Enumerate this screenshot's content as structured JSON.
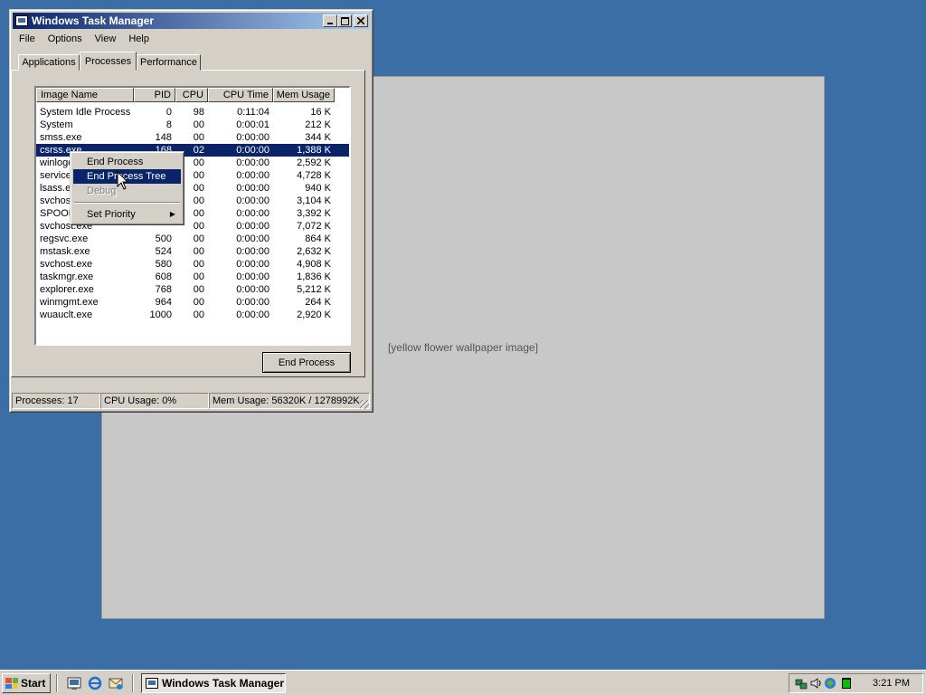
{
  "desktop": {
    "wallpaper_placeholder": "[yellow flower wallpaper image]"
  },
  "window": {
    "title": "Windows Task Manager",
    "menu": [
      "File",
      "Options",
      "View",
      "Help"
    ],
    "tabs": [
      "Applications",
      "Processes",
      "Performance"
    ],
    "active_tab": "Processes",
    "columns": [
      "Image Name",
      "PID",
      "CPU",
      "CPU Time",
      "Mem Usage"
    ],
    "rows": [
      {
        "name": "System Idle Process",
        "pid": "0",
        "cpu": "98",
        "time": "0:11:04",
        "mem": "16 K"
      },
      {
        "name": "System",
        "pid": "8",
        "cpu": "00",
        "time": "0:00:01",
        "mem": "212 K"
      },
      {
        "name": "smss.exe",
        "pid": "148",
        "cpu": "00",
        "time": "0:00:00",
        "mem": "344 K"
      },
      {
        "name": "csrss.exe",
        "pid": "168",
        "cpu": "02",
        "time": "0:00:00",
        "mem": "1,388 K",
        "selected": true
      },
      {
        "name": "winlogon.exe",
        "pid": "",
        "cpu": "00",
        "time": "0:00:00",
        "mem": "2,592 K"
      },
      {
        "name": "services.exe",
        "pid": "",
        "cpu": "00",
        "time": "0:00:00",
        "mem": "4,728 K"
      },
      {
        "name": "lsass.exe",
        "pid": "",
        "cpu": "00",
        "time": "0:00:00",
        "mem": "940 K"
      },
      {
        "name": "svchost.exe",
        "pid": "",
        "cpu": "00",
        "time": "0:00:00",
        "mem": "3,104 K"
      },
      {
        "name": "SPOOLSV.EXE",
        "pid": "",
        "cpu": "00",
        "time": "0:00:00",
        "mem": "3,392 K"
      },
      {
        "name": "svchost.exe",
        "pid": "",
        "cpu": "00",
        "time": "0:00:00",
        "mem": "7,072 K"
      },
      {
        "name": "regsvc.exe",
        "pid": "500",
        "cpu": "00",
        "time": "0:00:00",
        "mem": "864 K"
      },
      {
        "name": "mstask.exe",
        "pid": "524",
        "cpu": "00",
        "time": "0:00:00",
        "mem": "2,632 K"
      },
      {
        "name": "svchost.exe",
        "pid": "580",
        "cpu": "00",
        "time": "0:00:00",
        "mem": "4,908 K"
      },
      {
        "name": "taskmgr.exe",
        "pid": "608",
        "cpu": "00",
        "time": "0:00:00",
        "mem": "1,836 K"
      },
      {
        "name": "explorer.exe",
        "pid": "768",
        "cpu": "00",
        "time": "0:00:00",
        "mem": "5,212 K"
      },
      {
        "name": "winmgmt.exe",
        "pid": "964",
        "cpu": "00",
        "time": "0:00:00",
        "mem": "264 K"
      },
      {
        "name": "wuauclt.exe",
        "pid": "1000",
        "cpu": "00",
        "time": "0:00:00",
        "mem": "2,920 K"
      }
    ],
    "end_process_label": "End Process",
    "status": {
      "processes": "Processes: 17",
      "cpu": "CPU Usage: 0%",
      "mem": "Mem Usage: 56320K / 1278992K"
    }
  },
  "context_menu": {
    "items": [
      "End Process",
      "End Process Tree",
      "Debug",
      "Set Priority"
    ],
    "highlighted": "End Process Tree",
    "disabled": "Debug"
  },
  "taskbar": {
    "start_label": "Start",
    "task_label": "Windows Task Manager",
    "clock": "3:21 PM"
  }
}
